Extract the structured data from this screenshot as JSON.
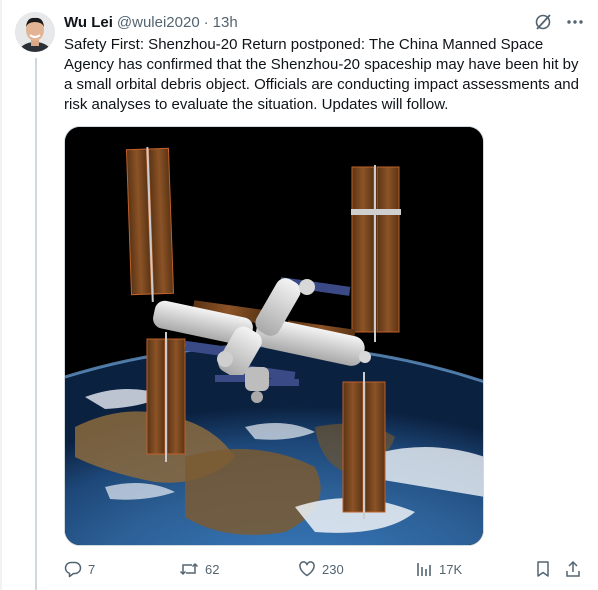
{
  "author": {
    "name": "Wu Lei",
    "handle": "@wulei2020",
    "separator": "·",
    "time": "13h"
  },
  "tweet": {
    "text": "Safety First: Shenzhou-20 Return postponed: The China Manned Space Agency has confirmed that the Shenzhou-20 spaceship may have been hit by a small orbital debris object. Officials are conducting impact assessments and risk analyses to evaluate the situation. Updates will follow."
  },
  "top_icons": [
    "grok-icon",
    "more-icon"
  ],
  "actions": {
    "replies": "7",
    "reposts": "62",
    "likes": "230",
    "views": "17K"
  },
  "colors": {
    "text": "#0f1419",
    "secondary": "#536471",
    "border": "#cfd9de"
  }
}
